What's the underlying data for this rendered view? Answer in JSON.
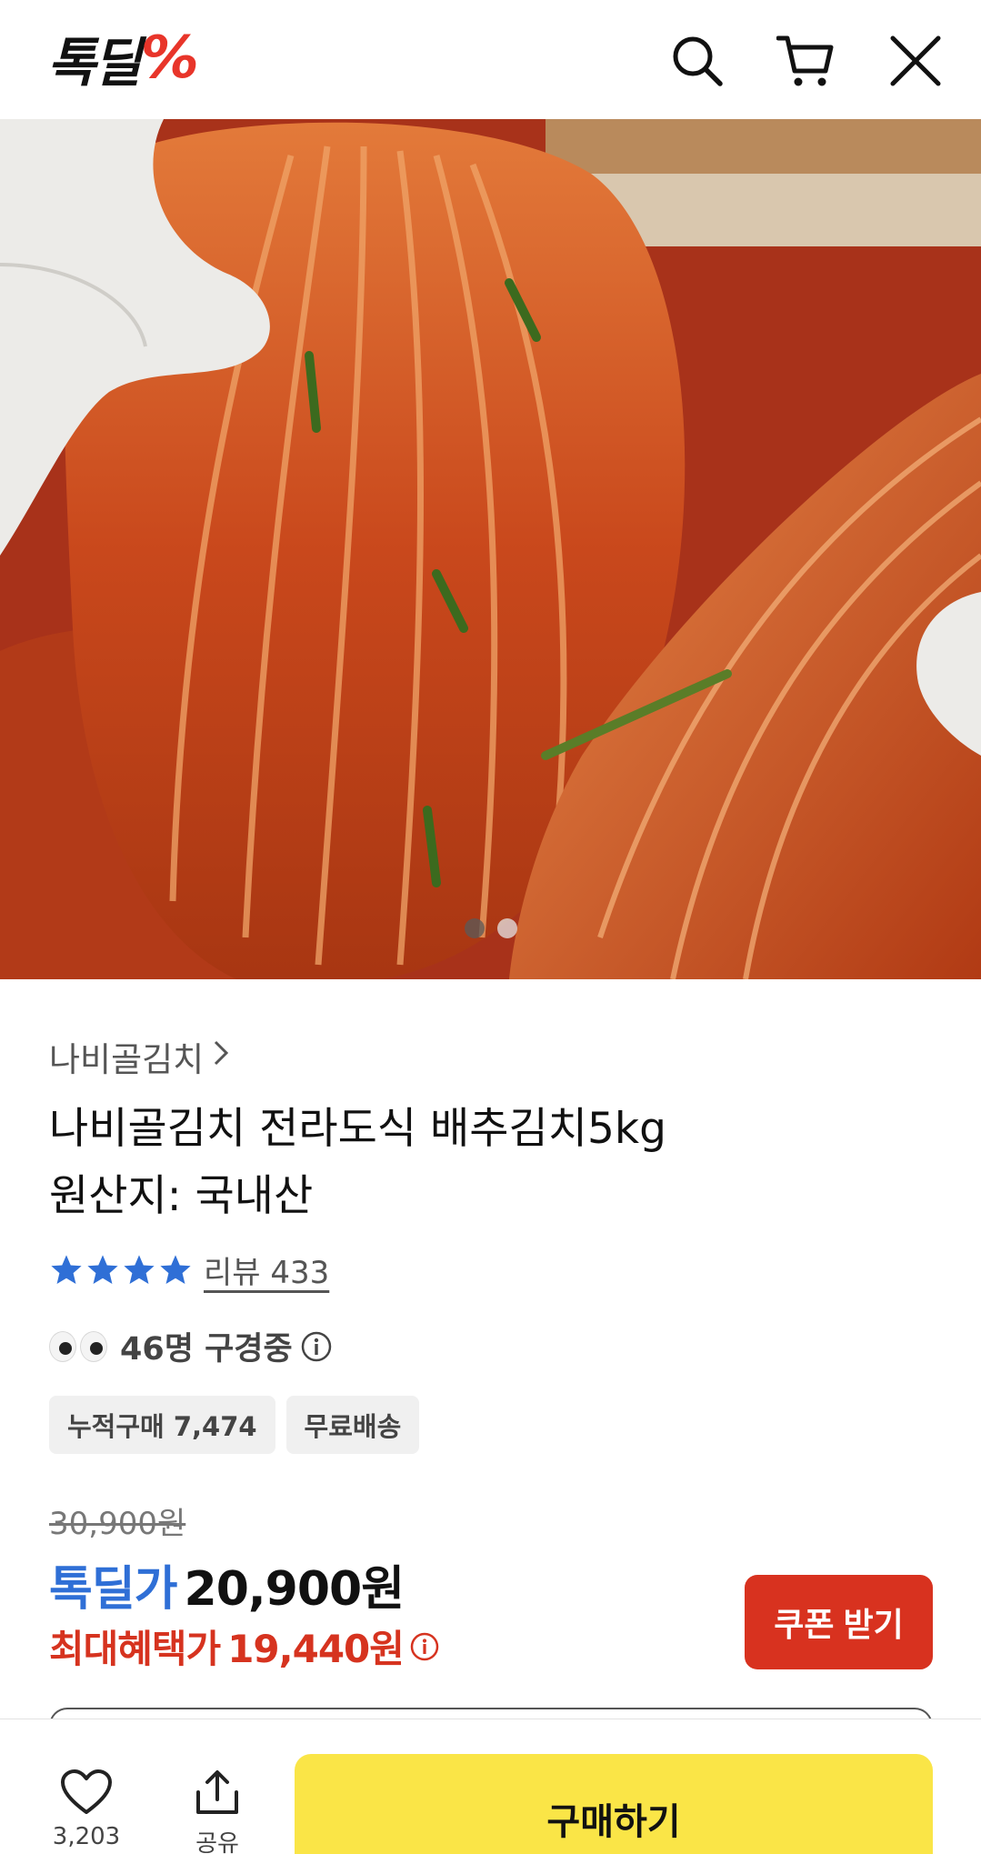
{
  "header": {
    "logo_text": "톡딜",
    "logo_mark": "%",
    "icons": [
      "search-icon",
      "cart-icon",
      "close-icon"
    ]
  },
  "hero": {
    "carousel_total": 2,
    "carousel_active": 1
  },
  "product": {
    "brand": "나비골김치",
    "title_line1": "나비골김치 전라도식 배추김치5kg",
    "title_line2": "원산지: 국내산",
    "rating_stars": 4,
    "review_label": "리뷰 433",
    "watching": "46명 구경중",
    "chips": [
      "누적구매 7,474",
      "무료배송"
    ]
  },
  "pricing": {
    "original_price": "30,900원",
    "sale_label": "톡딜가",
    "sale_price": "20,900원",
    "max_label": "최대혜택가",
    "max_price": "19,440원",
    "coupon_button": "쿠폰 받기"
  },
  "bottom_bar": {
    "like_count": "3,203",
    "share_label": "공유",
    "buy_button": "구매하기"
  },
  "colors": {
    "accent_blue": "#2f6fd6",
    "accent_red": "#d8321f",
    "buy_yellow": "#fae547",
    "logo_red": "#e8352a"
  }
}
